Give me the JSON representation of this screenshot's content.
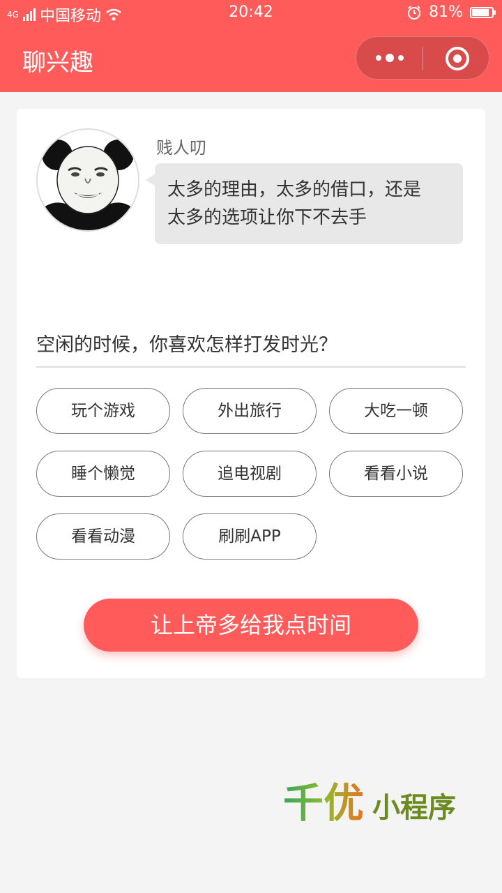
{
  "status_bar": {
    "network": "4G",
    "carrier": "中国移动",
    "time": "20:42",
    "battery": "81%",
    "battery_level": 0.81,
    "icons": [
      "signal-icon",
      "wifi-icon",
      "alarm-icon",
      "battery-icon"
    ]
  },
  "navbar": {
    "title": "聊兴趣",
    "accent_color": "#ff5b5b",
    "menu_icon": "more-dots-icon",
    "close_icon": "target-icon"
  },
  "chat": {
    "username": "贱人叨",
    "message_line1": "太多的理由，太多的借口，还是",
    "message_line2": "太多的选项让你下不去手",
    "avatar_icon": "panda-meme-avatar"
  },
  "question": "空闲的时候，你喜欢怎样打发时光？",
  "options": [
    "玩个游戏",
    "外出旅行",
    "大吃一顿",
    "睡个懒觉",
    "追电视剧",
    "看看小说",
    "看看动漫",
    "刷刷APP"
  ],
  "cta_label": "让上帝多给我点时间",
  "watermark": {
    "brand": "千优",
    "suffix": "小程序"
  }
}
